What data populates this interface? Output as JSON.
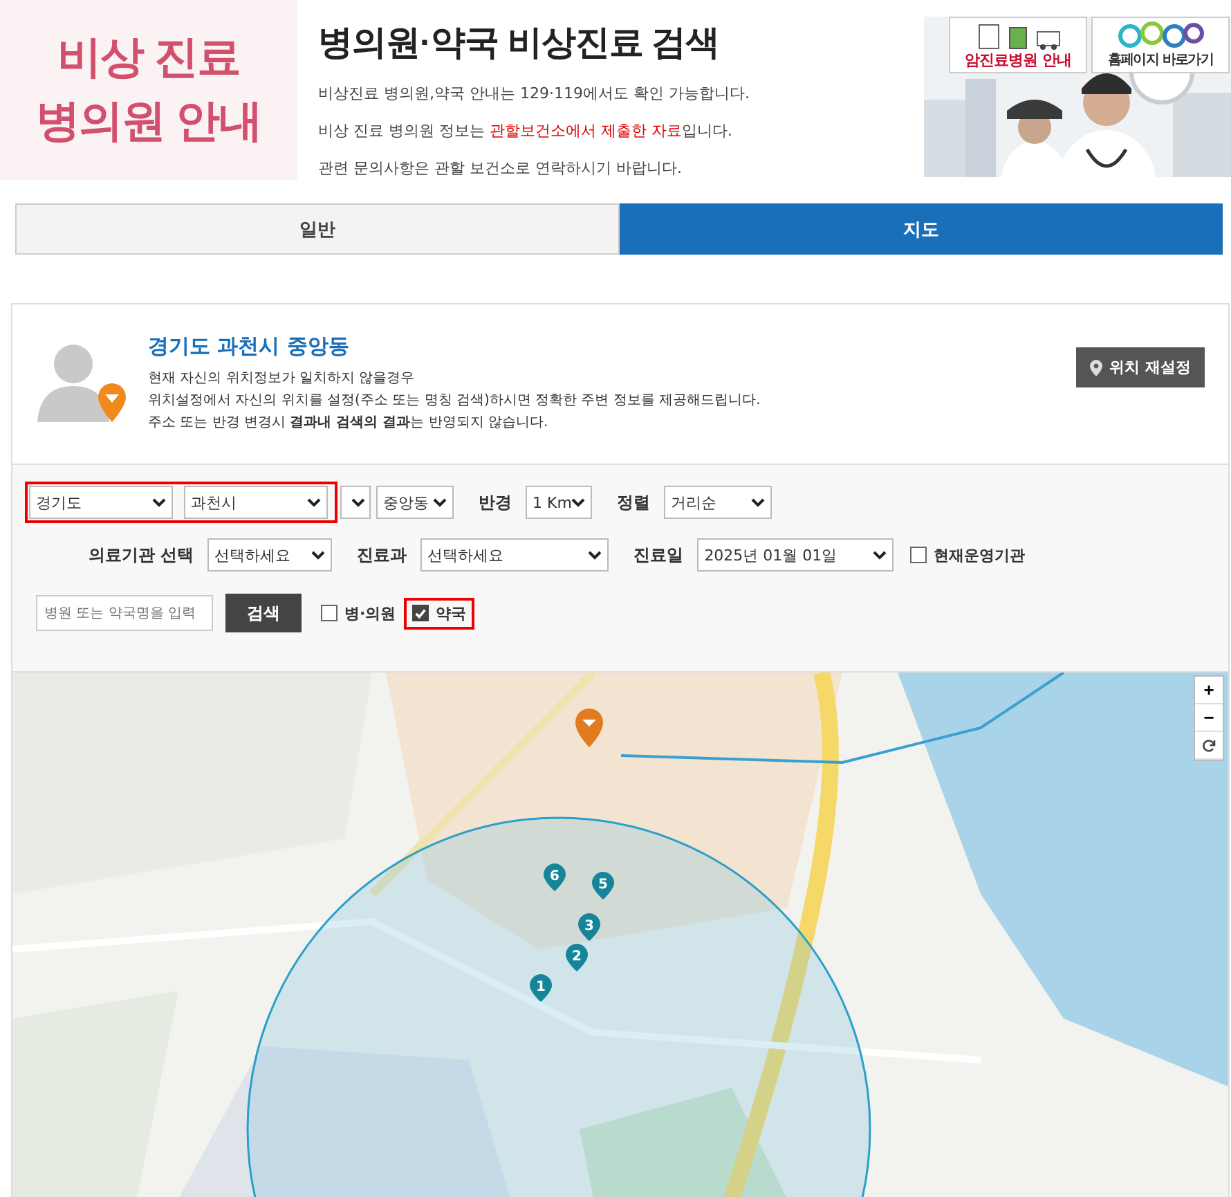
{
  "banner": {
    "left_lines": [
      "비상 진료",
      "병의원 안내"
    ],
    "title": "병의원·약국 비상진료 검색",
    "notes": [
      "비상진료 병의원,약국 안내는 129·119에서도 확인 가능합니다.",
      "비상 진료 병의원 정보는 **관할보건소에서 제출한 자료**입니다.",
      "관련 문의사항은 관할 보건소로 연락하시기 바랍니다."
    ],
    "links": [
      "암진료병원 안내",
      "홈페이지 바로가기"
    ]
  },
  "tabs": [
    {
      "label": "일반",
      "selected": false
    },
    {
      "label": "지도",
      "selected": true
    }
  ],
  "location": {
    "title": "경기도 과천시 중앙동",
    "lines": [
      "현재 자신의 위치정보가 일치하지 않을경우",
      "위치설정에서 자신의 위치를 설정(주소 또는 명칭 검색)하시면 정확한 주변 정보를 제공해드립니다.",
      "주소 또는 반경 변경시 **결과내 검색의 결과**는 반영되지 않습니다."
    ],
    "button": "위치 재설정"
  },
  "filters": {
    "region": {
      "highlighted": true,
      "selects": [
        "경기도",
        "과천시"
      ]
    },
    "dong": "중앙동",
    "radius_label": "반경",
    "radius": "1 Km",
    "sort_label": "정렬",
    "sort": "거리순",
    "institution_label": "의료기관 선택",
    "institution": "선택하세요",
    "dept_label": "진료과",
    "dept": "선택하세요",
    "date_label": "진료일",
    "date": "2025년 01월 01일",
    "open_now": {
      "label": "현재운영기관",
      "checked": false
    },
    "search": {
      "placeholder": "병원 또는 약국명을 입력"
    },
    "search_button": "검색",
    "types": [
      {
        "label": "병·의원",
        "checked": false,
        "highlighted": false
      },
      {
        "label": "약국",
        "checked": true,
        "highlighted": true
      }
    ]
  },
  "map": {
    "markers": [
      "1",
      "2",
      "3",
      "5",
      "6"
    ],
    "zoom_in": "+",
    "zoom_out": "−"
  }
}
